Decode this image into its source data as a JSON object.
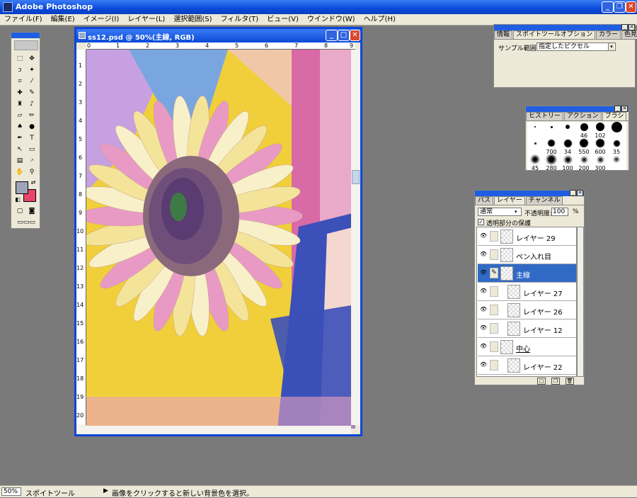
{
  "app": {
    "title": "Adobe Photoshop"
  },
  "menu": [
    "ファイル(F)",
    "編集(E)",
    "イメージ(I)",
    "レイヤー(L)",
    "選択範囲(S)",
    "フィルタ(T)",
    "ビュー(V)",
    "ウインドウ(W)",
    "ヘルプ(H)"
  ],
  "document": {
    "title": "ss12.psd @ 50%(主線, RGB)",
    "ruler_top": [
      "0",
      "1",
      "2",
      "3",
      "4",
      "5",
      "6",
      "7",
      "8",
      "9"
    ],
    "ruler_left": [
      "1",
      "2",
      "3",
      "4",
      "5",
      "6",
      "7",
      "8",
      "9",
      "10",
      "11",
      "12",
      "13",
      "14",
      "15",
      "16",
      "17",
      "18",
      "19",
      "20"
    ]
  },
  "options_palette": {
    "tabs": [
      "情報",
      "スポイトツールオプション",
      "カラー",
      "色見本"
    ],
    "sample_label": "サンプル範囲:",
    "sample_value": "指定したピクセル"
  },
  "brushes_palette": {
    "tabs": [
      "ヒストリー",
      "アクション",
      "ブラシ"
    ],
    "labels": [
      "46",
      "102",
      "700",
      "34",
      "550",
      "600",
      "35",
      "45",
      "280",
      "100",
      "200",
      "300"
    ]
  },
  "layers_palette": {
    "tabs": [
      "パス",
      "レイヤー",
      "チャンネル"
    ],
    "blend_mode": "通常",
    "opacity_label": "不透明度:",
    "opacity_value": "100",
    "opacity_unit": "%",
    "preserve_label": "透明部分の保護",
    "layers": [
      {
        "name": "レイヤー 29"
      },
      {
        "name": "ペン入れ目"
      },
      {
        "name": "主線"
      },
      {
        "name": "レイヤー 27"
      },
      {
        "name": "レイヤー 26"
      },
      {
        "name": "レイヤー 12"
      },
      {
        "name": "中心"
      },
      {
        "name": "レイヤー 22"
      }
    ]
  },
  "status": {
    "zoom": "50%",
    "tool": "スポイトツール",
    "hint": "画像をクリックすると新しい背景色を選択。"
  },
  "colors": {
    "foreground": "#a0a4b8",
    "background": "#e8456e",
    "accent": "#0b46d8"
  }
}
